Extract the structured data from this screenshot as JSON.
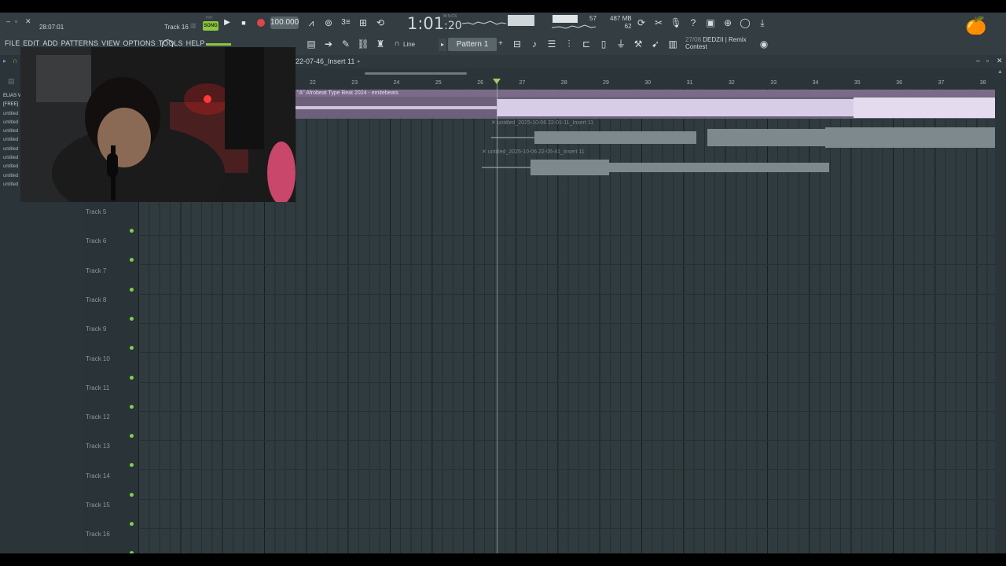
{
  "toolbar": {
    "clock": "28:07:01",
    "track_hint": "Track 16",
    "pat_label": "PAT",
    "song_label": "SONG",
    "tempo": "100.000",
    "time_main": "1:01",
    "time_sub": "20",
    "msc_label": "M:S:CS",
    "poly": "57",
    "mem": "487 MB",
    "cpu": "62",
    "pattern_name": "Pattern 1",
    "snap_mode": "Line",
    "news_date": "27/08",
    "news_text": "DEDZII | Remix",
    "news_text2": "Contest"
  },
  "menu": [
    "FILE",
    "EDIT",
    "ADD",
    "PATTERNS",
    "VIEW",
    "OPTIONS",
    "TOOLS",
    "HELP"
  ],
  "playlist": {
    "title": "22-07-46_Insert 11",
    "ruler": [
      "22",
      "23",
      "24",
      "25",
      "26",
      "27",
      "28",
      "29",
      "30",
      "31",
      "32",
      "33",
      "34",
      "35",
      "36",
      "37",
      "38"
    ],
    "clips": {
      "clip1": "\"A\" Afrobeat Type Beat 2024 - emitebeats",
      "clip2": "untitled_2025-10-06 22-01-11_Insert 11",
      "clip3": "untitled_2025-10-06 22-05-41_Insert 11"
    },
    "tracks": [
      "Track 5",
      "Track 6",
      "Track 7",
      "Track 8",
      "Track 9",
      "Track 10",
      "Track 11",
      "Track 12",
      "Track 13",
      "Track 14",
      "Track 15",
      "Track 16"
    ]
  },
  "browser": {
    "items": [
      "ELIAS V",
      "[FREE]",
      "untitled",
      "untitled",
      "untitled",
      "untitled",
      "untitled",
      "untitled",
      "untitled",
      "untitled",
      "untitled"
    ]
  },
  "colors": {
    "accent_green": "#8ec63f",
    "clip_purple": "#7b6b88",
    "record_red": "#e14646"
  }
}
